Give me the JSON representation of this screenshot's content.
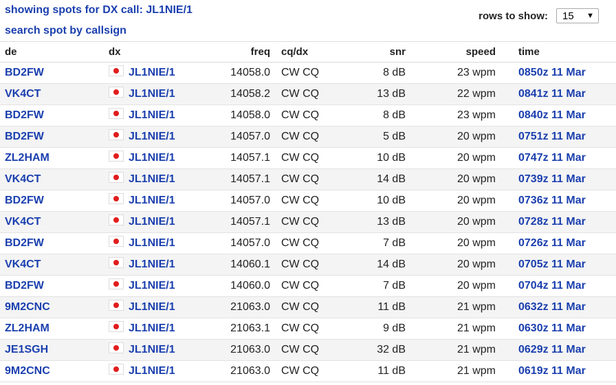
{
  "header": {
    "showing_text": "showing spots for DX call: JL1NIE/1",
    "search_link": "search spot by callsign",
    "rows_label": "rows to show:",
    "rows_value": "15"
  },
  "columns": {
    "de": "de",
    "dx": "dx",
    "freq": "freq",
    "cq": "cq/dx",
    "snr": "snr",
    "speed": "speed",
    "time": "time"
  },
  "rows": [
    {
      "de": "BD2FW",
      "dx": "JL1NIE/1",
      "freq": "14058.0",
      "cq": "CW CQ",
      "snr": "8 dB",
      "speed": "23 wpm",
      "time": "0850z 11 Mar"
    },
    {
      "de": "VK4CT",
      "dx": "JL1NIE/1",
      "freq": "14058.2",
      "cq": "CW CQ",
      "snr": "13 dB",
      "speed": "22 wpm",
      "time": "0841z 11 Mar"
    },
    {
      "de": "BD2FW",
      "dx": "JL1NIE/1",
      "freq": "14058.0",
      "cq": "CW CQ",
      "snr": "8 dB",
      "speed": "23 wpm",
      "time": "0840z 11 Mar"
    },
    {
      "de": "BD2FW",
      "dx": "JL1NIE/1",
      "freq": "14057.0",
      "cq": "CW CQ",
      "snr": "5 dB",
      "speed": "20 wpm",
      "time": "0751z 11 Mar"
    },
    {
      "de": "ZL2HAM",
      "dx": "JL1NIE/1",
      "freq": "14057.1",
      "cq": "CW CQ",
      "snr": "10 dB",
      "speed": "20 wpm",
      "time": "0747z 11 Mar"
    },
    {
      "de": "VK4CT",
      "dx": "JL1NIE/1",
      "freq": "14057.1",
      "cq": "CW CQ",
      "snr": "14 dB",
      "speed": "20 wpm",
      "time": "0739z 11 Mar"
    },
    {
      "de": "BD2FW",
      "dx": "JL1NIE/1",
      "freq": "14057.0",
      "cq": "CW CQ",
      "snr": "10 dB",
      "speed": "20 wpm",
      "time": "0736z 11 Mar"
    },
    {
      "de": "VK4CT",
      "dx": "JL1NIE/1",
      "freq": "14057.1",
      "cq": "CW CQ",
      "snr": "13 dB",
      "speed": "20 wpm",
      "time": "0728z 11 Mar"
    },
    {
      "de": "BD2FW",
      "dx": "JL1NIE/1",
      "freq": "14057.0",
      "cq": "CW CQ",
      "snr": "7 dB",
      "speed": "20 wpm",
      "time": "0726z 11 Mar"
    },
    {
      "de": "VK4CT",
      "dx": "JL1NIE/1",
      "freq": "14060.1",
      "cq": "CW CQ",
      "snr": "14 dB",
      "speed": "20 wpm",
      "time": "0705z 11 Mar"
    },
    {
      "de": "BD2FW",
      "dx": "JL1NIE/1",
      "freq": "14060.0",
      "cq": "CW CQ",
      "snr": "7 dB",
      "speed": "20 wpm",
      "time": "0704z 11 Mar"
    },
    {
      "de": "9M2CNC",
      "dx": "JL1NIE/1",
      "freq": "21063.0",
      "cq": "CW CQ",
      "snr": "11 dB",
      "speed": "21 wpm",
      "time": "0632z 11 Mar"
    },
    {
      "de": "ZL2HAM",
      "dx": "JL1NIE/1",
      "freq": "21063.1",
      "cq": "CW CQ",
      "snr": "9 dB",
      "speed": "21 wpm",
      "time": "0630z 11 Mar"
    },
    {
      "de": "JE1SGH",
      "dx": "JL1NIE/1",
      "freq": "21063.0",
      "cq": "CW CQ",
      "snr": "32 dB",
      "speed": "21 wpm",
      "time": "0629z 11 Mar"
    },
    {
      "de": "9M2CNC",
      "dx": "JL1NIE/1",
      "freq": "21063.0",
      "cq": "CW CQ",
      "snr": "11 dB",
      "speed": "21 wpm",
      "time": "0619z 11 Mar"
    }
  ],
  "colors": {
    "link": "#1a3fae",
    "row_alt": "#f4f4f4",
    "flag_red": "#e21c1c"
  },
  "icons": {
    "flag": "japan-flag-icon",
    "dropdown": "chevron-down-icon"
  }
}
